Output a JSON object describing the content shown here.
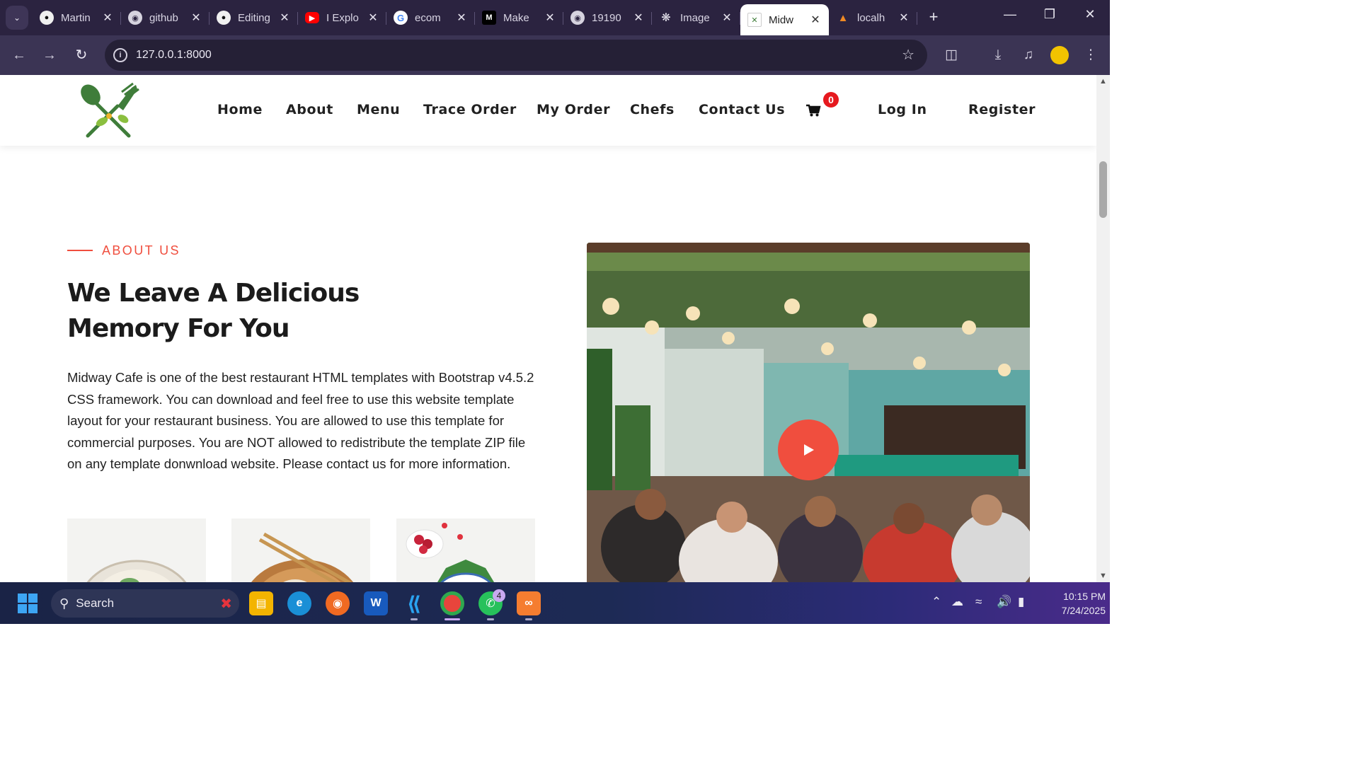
{
  "browser": {
    "tabs": [
      {
        "title": "Martin",
        "icon": "github-icon"
      },
      {
        "title": "github",
        "icon": "globe-icon"
      },
      {
        "title": "Editing",
        "icon": "github-icon"
      },
      {
        "title": "I Explo",
        "icon": "youtube-icon"
      },
      {
        "title": "ecom",
        "icon": "google-icon"
      },
      {
        "title": "Make",
        "icon": "medium-icon"
      },
      {
        "title": "19190",
        "icon": "globe-icon"
      },
      {
        "title": "Image",
        "icon": "openai-icon"
      },
      {
        "title": "Midw",
        "icon": "site-icon",
        "active": true
      },
      {
        "title": "localh",
        "icon": "xampp-icon"
      }
    ],
    "url": "127.0.0.1:8000"
  },
  "site": {
    "nav": {
      "home": "Home",
      "about": "About",
      "menu": "Menu",
      "trace_order": "Trace Order",
      "my_order": "My Order",
      "chefs": "Chefs",
      "contact_us": "Contact Us",
      "cart_count": "0",
      "login": "Log In",
      "register": "Register"
    },
    "about": {
      "eyebrow": "ABOUT US",
      "headline_line1": "We Leave A Delicious",
      "headline_line2": "Memory For You",
      "body": "Midway Cafe is one of the best restaurant HTML templates with Bootstrap v4.5.2 CSS framework. You can download and feel free to use this website template layout for your restaurant business. You are allowed to use this template for commercial purposes. You are NOT allowed to redistribute the template ZIP file on any template donwnload website. Please contact us for more information."
    },
    "colors": {
      "accent": "#f04e3e",
      "logo_green": "#3f7d3a"
    }
  },
  "taskbar": {
    "search_label": "Search",
    "whatsapp_badge": "4",
    "time": "10:15 PM",
    "date": "7/24/2025"
  }
}
